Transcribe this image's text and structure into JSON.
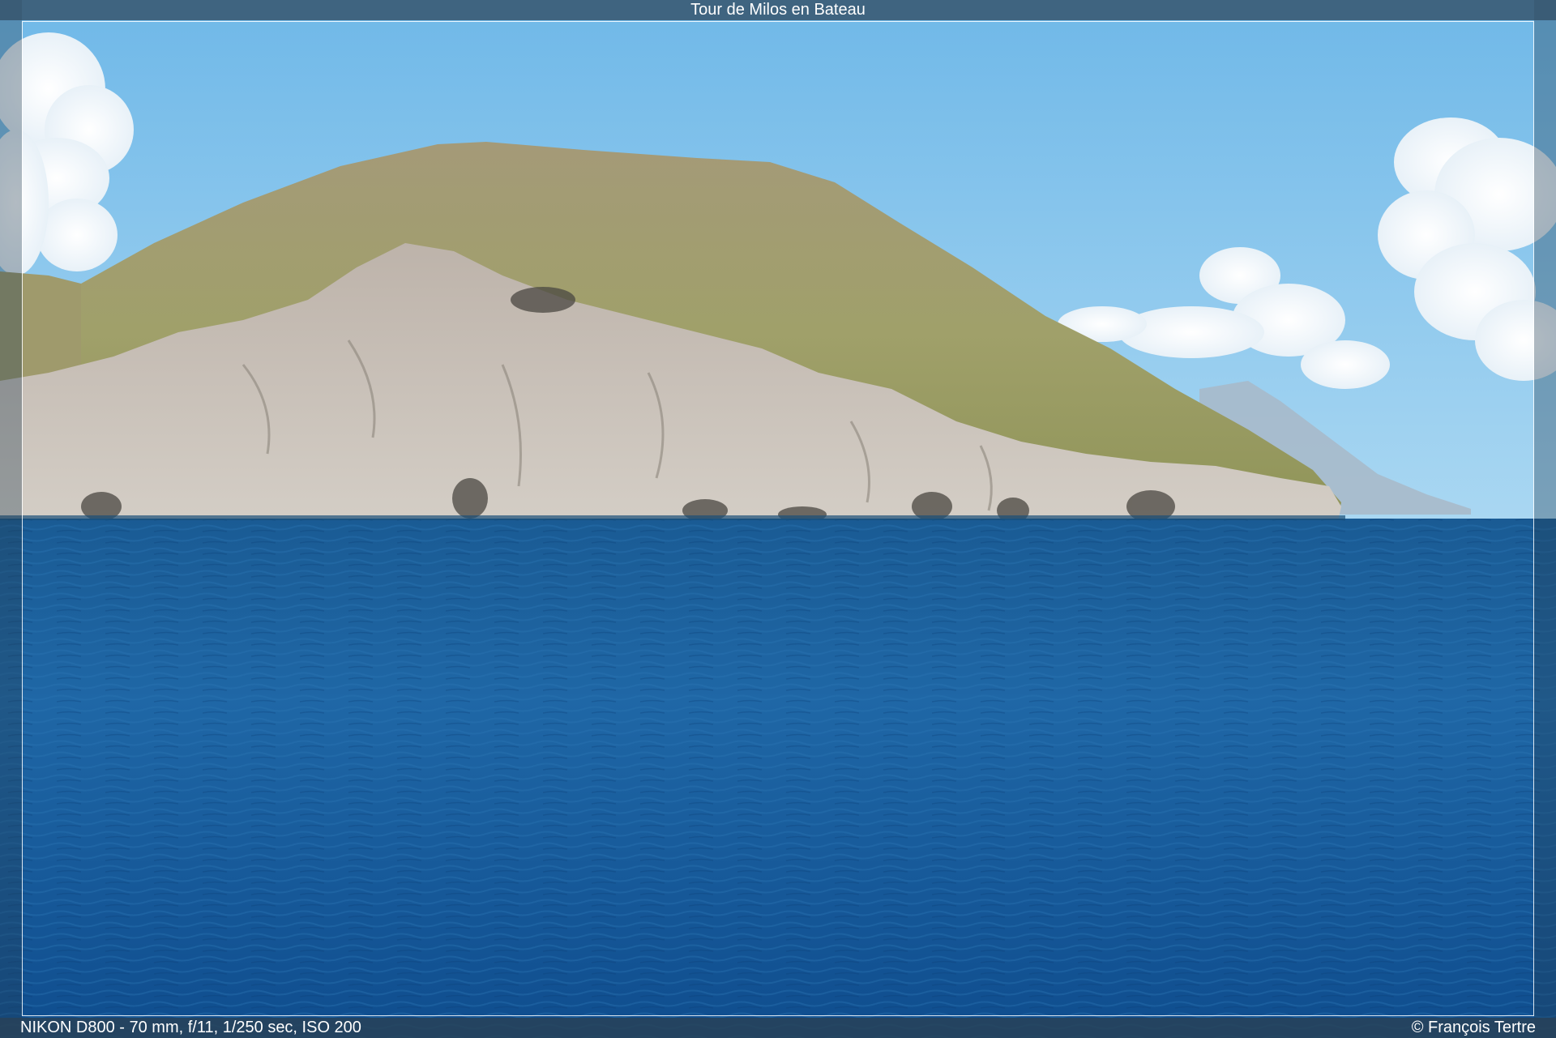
{
  "header": {
    "title": "Tour de Milos en Bateau"
  },
  "footer": {
    "exif": "NIKON D800 - 70 mm, f/11, 1/250 sec, ISO 200",
    "copyright": "© François Tertre"
  },
  "colors": {
    "sky": "#86c6ee",
    "sea": "#1d5f9a",
    "cliff": "#c9c2b9",
    "vegetation": "#9a9a5c",
    "frame": "#3f5f76"
  }
}
